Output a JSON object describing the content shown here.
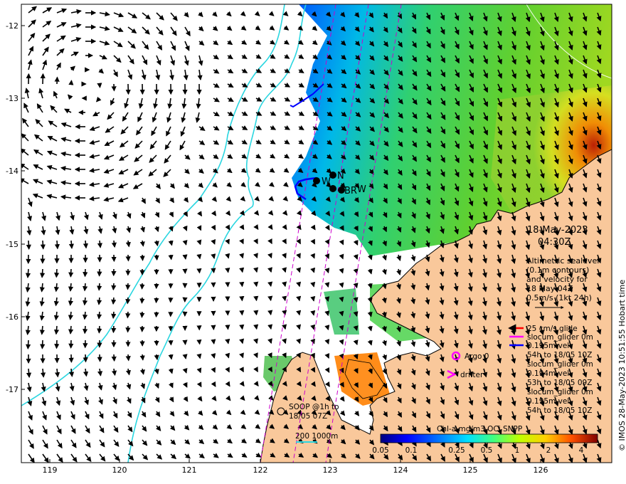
{
  "map": {
    "lon_ticks": [
      "119",
      "120",
      "121",
      "122",
      "123",
      "124",
      "125",
      "126"
    ],
    "lat_ticks": [
      "-12",
      "-13",
      "-14",
      "-15",
      "-16",
      "-17"
    ],
    "colors": {
      "land": "#f9c89b",
      "coast": "#000000",
      "bathy": "#2ad6e0",
      "ocean": "#ffffff",
      "track": "#cc00cc"
    }
  },
  "datetime": {
    "date": "18-May-2023",
    "time": "04:30Z"
  },
  "altimetry": [
    "Altimetric sealevel",
    "(0.1m contours)",
    "and velocity for",
    "18 May 04Z",
    "0.5m/s (1kt 24h)"
  ],
  "glider_legend": {
    "title": "25 cm/s glide",
    "entries": [
      {
        "name": "slocum_glider 0m",
        "vel": "0.195m vel",
        "time": "54h to 18/05 10Z",
        "color": "#ff00ff",
        "icon": "arrow-left-icon"
      },
      {
        "name": "slocum_glider 0m",
        "vel": "0.194m vel",
        "time": "53h to 18/05 09Z",
        "color": "#0000ff",
        "icon": "arrow-left-icon"
      },
      {
        "name": "slocum_glider 0m",
        "vel": "0.195m vel",
        "time": "54h to 18/05 10Z",
        "color": "#0000ff",
        "icon": "arrow-left-icon"
      }
    ],
    "title_color": "#ff0000"
  },
  "argo": {
    "label": "Argo 0"
  },
  "drifter": {
    "label": "drifter"
  },
  "soop": {
    "line1": "SOOP @1h to",
    "line2": "18/05 07Z"
  },
  "bathy_legend": {
    "label": "200  1000m"
  },
  "colorbar": {
    "title": "Chl-a mg/m3 OCi SNPP",
    "ticks": [
      "0.05",
      "0.1",
      "0.25",
      "0.5",
      "1",
      "2",
      "4"
    ]
  },
  "mooring_labels": [
    "N",
    "W",
    "BR",
    "W"
  ],
  "credit": "© IMOS 28-May-2023 10:51:55 Hobart time"
}
